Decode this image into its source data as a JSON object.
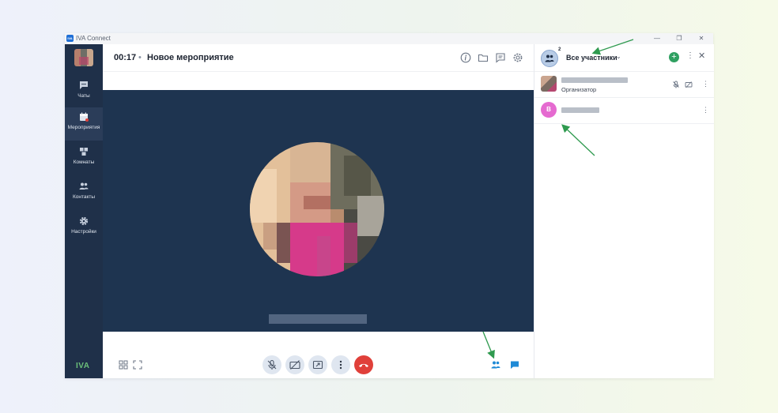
{
  "window": {
    "app_title": "IVA Connect",
    "controls": {
      "minimize": "—",
      "restore": "❐",
      "close": "✕"
    }
  },
  "sidebar": {
    "items": [
      {
        "label": "Чаты",
        "icon": "chat-icon",
        "active": false
      },
      {
        "label": "Мероприятия",
        "icon": "calendar-icon",
        "active": true
      },
      {
        "label": "Комнаты",
        "icon": "rooms-icon",
        "active": false
      },
      {
        "label": "Контакты",
        "icon": "contacts-icon",
        "active": false
      },
      {
        "label": "Настройки",
        "icon": "gear-icon",
        "active": false
      }
    ],
    "brand": "IVA"
  },
  "header": {
    "timer": "00:17",
    "separator": "•",
    "title": "Новое мероприятие",
    "icons": [
      "info-icon",
      "folder-icon",
      "notes-icon",
      "settings-icon"
    ]
  },
  "panel": {
    "title": "Все участники",
    "participant_count": "2",
    "participants": [
      {
        "role": "Организатор",
        "avatar": "photo"
      },
      {
        "role": "",
        "avatar_letter": "В",
        "avatar_color": "#e56ad0"
      }
    ]
  },
  "controls": {
    "left": [
      "grid-layout-icon",
      "fullscreen-icon"
    ],
    "center": [
      "microphone-off-icon",
      "camera-off-icon",
      "share-screen-icon",
      "more-vertical-icon",
      "hangup-icon"
    ],
    "right": [
      "participants-icon",
      "chat-icon"
    ]
  },
  "colors": {
    "sidebar_bg": "#1f3049",
    "stage_bg": "#1e3450",
    "accent_green": "#2fa061",
    "hangup_red": "#e0403a",
    "active_blue": "#1f8ad6"
  }
}
